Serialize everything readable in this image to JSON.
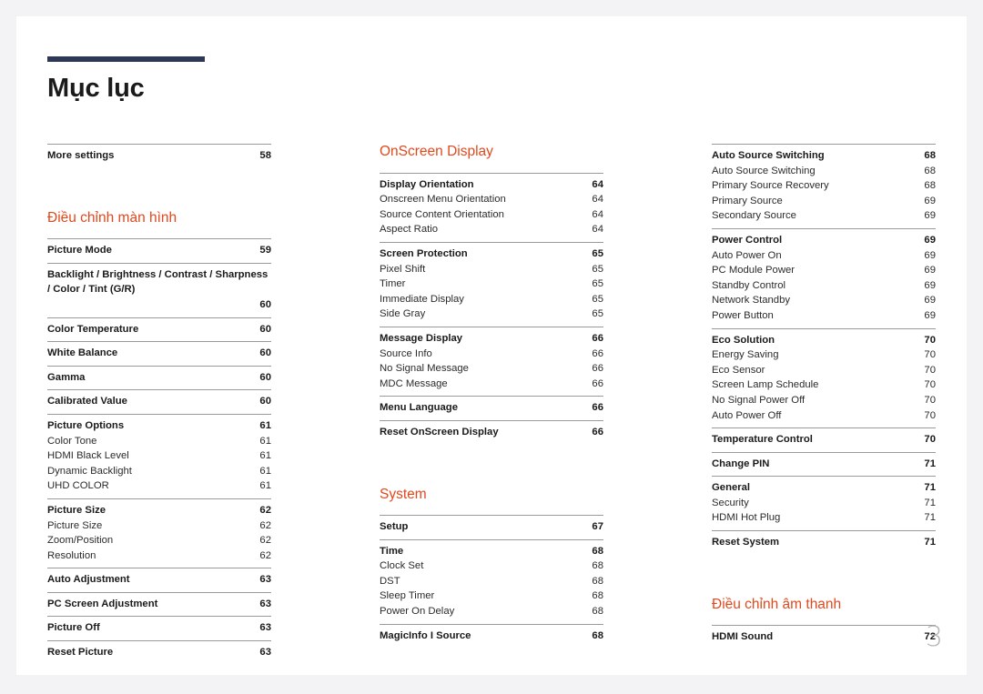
{
  "document": {
    "title": "Mục lục",
    "folio": "3",
    "accent_color": "#e1491d",
    "rule_color": "#2e3855",
    "page_background": "#ffffff",
    "canvas_background": "#f3f3f5"
  },
  "columns": [
    {
      "name": "column-1",
      "blocks": [
        {
          "type": "groups",
          "groups": [
            {
              "entries": [
                {
                  "level": "main",
                  "label": "More settings",
                  "page": "58"
                }
              ]
            }
          ]
        },
        {
          "type": "gap",
          "size": "large"
        },
        {
          "type": "section",
          "heading": "Điều chỉnh màn hình"
        },
        {
          "type": "groups",
          "groups": [
            {
              "entries": [
                {
                  "level": "main",
                  "label": "Picture Mode",
                  "page": "59"
                }
              ]
            },
            {
              "entries": [
                {
                  "level": "main",
                  "wrap": true,
                  "label": "Backlight / Brightness / Contrast / Sharpness / Color / Tint (G/R)",
                  "page": "60"
                }
              ]
            },
            {
              "entries": [
                {
                  "level": "main",
                  "label": "Color Temperature",
                  "page": "60"
                }
              ]
            },
            {
              "entries": [
                {
                  "level": "main",
                  "label": "White Balance",
                  "page": "60"
                }
              ]
            },
            {
              "entries": [
                {
                  "level": "main",
                  "label": "Gamma",
                  "page": "60"
                }
              ]
            },
            {
              "entries": [
                {
                  "level": "main",
                  "label": "Calibrated Value",
                  "page": "60"
                }
              ]
            },
            {
              "entries": [
                {
                  "level": "main",
                  "label": "Picture Options",
                  "page": "61"
                },
                {
                  "level": "sub",
                  "label": "Color Tone",
                  "page": "61"
                },
                {
                  "level": "sub",
                  "label": "HDMI Black Level",
                  "page": "61"
                },
                {
                  "level": "sub",
                  "label": "Dynamic Backlight",
                  "page": "61"
                },
                {
                  "level": "sub",
                  "label": "UHD COLOR",
                  "page": "61"
                }
              ]
            },
            {
              "entries": [
                {
                  "level": "main",
                  "label": "Picture Size",
                  "page": "62"
                },
                {
                  "level": "sub",
                  "label": "Picture Size",
                  "page": "62"
                },
                {
                  "level": "sub",
                  "label": "Zoom/Position",
                  "page": "62"
                },
                {
                  "level": "sub",
                  "label": "Resolution",
                  "page": "62"
                }
              ]
            },
            {
              "entries": [
                {
                  "level": "main",
                  "label": "Auto Adjustment",
                  "page": "63"
                }
              ]
            },
            {
              "entries": [
                {
                  "level": "main",
                  "label": "PC Screen Adjustment",
                  "page": "63"
                }
              ]
            },
            {
              "entries": [
                {
                  "level": "main",
                  "label": "Picture Off",
                  "page": "63"
                }
              ]
            },
            {
              "entries": [
                {
                  "level": "main",
                  "label": "Reset Picture",
                  "page": "63"
                }
              ]
            }
          ]
        }
      ]
    },
    {
      "name": "column-2",
      "blocks": [
        {
          "type": "section",
          "heading": "OnScreen Display"
        },
        {
          "type": "groups",
          "groups": [
            {
              "entries": [
                {
                  "level": "main",
                  "label": "Display Orientation",
                  "page": "64"
                },
                {
                  "level": "sub",
                  "label": "Onscreen Menu Orientation",
                  "page": "64"
                },
                {
                  "level": "sub",
                  "label": "Source Content Orientation",
                  "page": "64"
                },
                {
                  "level": "sub",
                  "label": "Aspect Ratio",
                  "page": "64"
                }
              ]
            },
            {
              "entries": [
                {
                  "level": "main",
                  "label": "Screen Protection",
                  "page": "65"
                },
                {
                  "level": "sub",
                  "label": "Pixel Shift",
                  "page": "65"
                },
                {
                  "level": "sub",
                  "label": "Timer",
                  "page": "65"
                },
                {
                  "level": "sub",
                  "label": "Immediate Display",
                  "page": "65"
                },
                {
                  "level": "sub",
                  "label": "Side Gray",
                  "page": "65"
                }
              ]
            },
            {
              "entries": [
                {
                  "level": "main",
                  "label": "Message Display",
                  "page": "66"
                },
                {
                  "level": "sub",
                  "label": "Source Info",
                  "page": "66"
                },
                {
                  "level": "sub",
                  "label": "No Signal Message",
                  "page": "66"
                },
                {
                  "level": "sub",
                  "label": "MDC Message",
                  "page": "66"
                }
              ]
            },
            {
              "entries": [
                {
                  "level": "main",
                  "label": "Menu Language",
                  "page": "66"
                }
              ]
            },
            {
              "entries": [
                {
                  "level": "main",
                  "label": "Reset OnScreen Display",
                  "page": "66"
                }
              ]
            }
          ]
        },
        {
          "type": "gap",
          "size": "large"
        },
        {
          "type": "section",
          "heading": "System"
        },
        {
          "type": "groups",
          "groups": [
            {
              "entries": [
                {
                  "level": "main",
                  "label": "Setup",
                  "page": "67"
                }
              ]
            },
            {
              "entries": [
                {
                  "level": "main",
                  "label": "Time",
                  "page": "68"
                },
                {
                  "level": "sub",
                  "label": "Clock Set",
                  "page": "68"
                },
                {
                  "level": "sub",
                  "label": "DST",
                  "page": "68"
                },
                {
                  "level": "sub",
                  "label": "Sleep Timer",
                  "page": "68"
                },
                {
                  "level": "sub",
                  "label": "Power On Delay",
                  "page": "68"
                }
              ]
            },
            {
              "entries": [
                {
                  "level": "main",
                  "label": "MagicInfo I Source",
                  "page": "68"
                }
              ]
            }
          ]
        }
      ]
    },
    {
      "name": "column-3",
      "blocks": [
        {
          "type": "groups",
          "groups": [
            {
              "entries": [
                {
                  "level": "main",
                  "label": "Auto Source Switching",
                  "page": "68"
                },
                {
                  "level": "sub",
                  "label": "Auto Source Switching",
                  "page": "68"
                },
                {
                  "level": "sub",
                  "label": "Primary Source Recovery",
                  "page": "68"
                },
                {
                  "level": "sub",
                  "label": "Primary Source",
                  "page": "69"
                },
                {
                  "level": "sub",
                  "label": "Secondary Source",
                  "page": "69"
                }
              ]
            },
            {
              "entries": [
                {
                  "level": "main",
                  "label": "Power Control",
                  "page": "69"
                },
                {
                  "level": "sub",
                  "label": "Auto Power On",
                  "page": "69"
                },
                {
                  "level": "sub",
                  "label": "PC Module Power",
                  "page": "69"
                },
                {
                  "level": "sub",
                  "label": "Standby Control",
                  "page": "69"
                },
                {
                  "level": "sub",
                  "label": "Network Standby",
                  "page": "69"
                },
                {
                  "level": "sub",
                  "label": "Power Button",
                  "page": "69"
                }
              ]
            },
            {
              "entries": [
                {
                  "level": "main",
                  "label": "Eco Solution",
                  "page": "70"
                },
                {
                  "level": "sub",
                  "label": "Energy Saving",
                  "page": "70"
                },
                {
                  "level": "sub",
                  "label": "Eco Sensor",
                  "page": "70"
                },
                {
                  "level": "sub",
                  "label": "Screen Lamp Schedule",
                  "page": "70"
                },
                {
                  "level": "sub",
                  "label": "No Signal Power Off",
                  "page": "70"
                },
                {
                  "level": "sub",
                  "label": "Auto Power Off",
                  "page": "70"
                }
              ]
            },
            {
              "entries": [
                {
                  "level": "main",
                  "label": "Temperature Control",
                  "page": "70"
                }
              ]
            },
            {
              "entries": [
                {
                  "level": "main",
                  "label": "Change PIN",
                  "page": "71"
                }
              ]
            },
            {
              "entries": [
                {
                  "level": "main",
                  "label": "General",
                  "page": "71"
                },
                {
                  "level": "sub",
                  "label": "Security",
                  "page": "71"
                },
                {
                  "level": "sub",
                  "label": "HDMI Hot Plug",
                  "page": "71"
                }
              ]
            },
            {
              "entries": [
                {
                  "level": "main",
                  "label": "Reset System",
                  "page": "71"
                }
              ]
            }
          ]
        },
        {
          "type": "gap",
          "size": "large"
        },
        {
          "type": "section",
          "heading": "Điều chỉnh âm thanh"
        },
        {
          "type": "groups",
          "groups": [
            {
              "entries": [
                {
                  "level": "main",
                  "label": "HDMI Sound",
                  "page": "72"
                }
              ]
            }
          ]
        }
      ]
    }
  ]
}
